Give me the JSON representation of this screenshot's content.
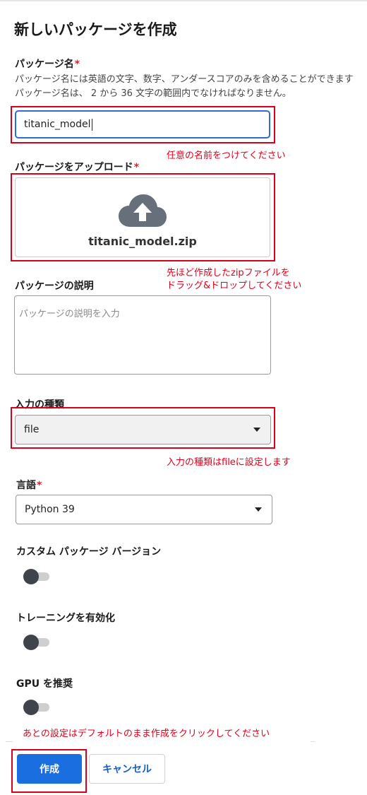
{
  "page_title": "新しいパッケージを作成",
  "package_name": {
    "label": "パッケージ名",
    "required_mark": "*",
    "help_line1": "パッケージ名には英語の文字、数字、アンダースコアのみを含めることができます",
    "help_line2": "パッケージ名は、 2 から 36 文字の範囲内でなければなりません。",
    "value": "titanic_model",
    "annotation": "任意の名前をつけてください"
  },
  "upload": {
    "label": "パッケージをアップロード",
    "required_mark": "*",
    "file_name": "titanic_model.zip",
    "icon": "cloud-upload-icon",
    "annotation_line1": "先ほど作成したzipファイルを",
    "annotation_line2": "ドラッグ&ドロップしてください"
  },
  "description": {
    "label": "パッケージの説明",
    "placeholder": "パッケージの説明を入力"
  },
  "input_type": {
    "label": "入力の種類",
    "selected": "file",
    "annotation": "入力の種類はfileに設定します"
  },
  "language": {
    "label": "言語",
    "required_mark": "*",
    "selected": "Python 39"
  },
  "custom_version": {
    "label": "カスタム パッケージ バージョン",
    "enabled": false
  },
  "training": {
    "label": "トレーニングを有効化",
    "enabled": false
  },
  "gpu": {
    "label": "GPU を推奨",
    "enabled": false
  },
  "footer_annotation": "あとの設定はデフォルトのまま作成をクリックしてください",
  "buttons": {
    "create": "作成",
    "cancel": "キャンセル"
  },
  "colors": {
    "primary": "#1a6ee0",
    "annotation_red": "#e0001b",
    "required_red": "#d6232b"
  }
}
